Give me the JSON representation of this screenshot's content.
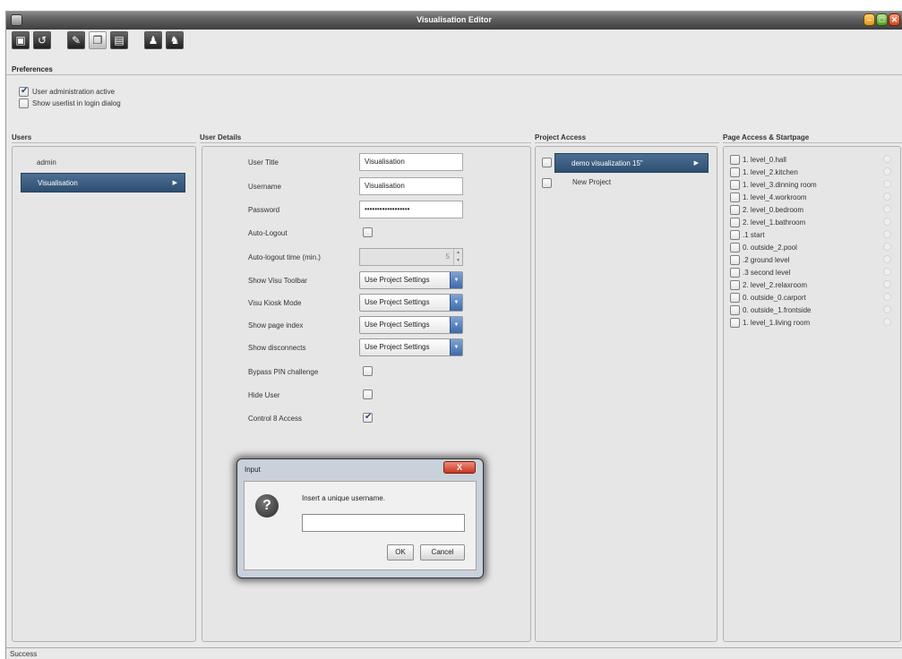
{
  "window": {
    "title": "Visualisation Editor"
  },
  "toolbar": {
    "buttons": [
      "new-icon",
      "undo-icon",
      "edit-icon",
      "copy-icon",
      "film-icon",
      "user-icon",
      "user-export-icon"
    ]
  },
  "preferences": {
    "title": "Preferences",
    "options": [
      {
        "label": "User administration active",
        "checked": true
      },
      {
        "label": "Show userlist in login dialog",
        "checked": false
      }
    ]
  },
  "users": {
    "title": "Users",
    "items": [
      "admin",
      "Visualisation"
    ],
    "selected": "Visualisation"
  },
  "user_details": {
    "title": "User Details",
    "user_title": {
      "label": "User Title",
      "value": "Visualisation"
    },
    "username": {
      "label": "Username",
      "value": "Visualisation"
    },
    "password": {
      "label": "Password",
      "value": "••••••••••••••••••"
    },
    "auto_logout": {
      "label": "Auto-Logout",
      "checked": false
    },
    "auto_logout_time": {
      "label": "Auto-logout time (min.)",
      "value": "5"
    },
    "show_visu_toolbar": {
      "label": "Show Visu Toolbar",
      "value": "Use Project Settings"
    },
    "visu_kiosk_mode": {
      "label": "Visu Kiosk Mode",
      "value": "Use Project Settings"
    },
    "show_page_index": {
      "label": "Show page index",
      "value": "Use Project Settings"
    },
    "show_disconnects": {
      "label": "Show disconnects",
      "value": "Use Project Settings"
    },
    "bypass_pin": {
      "label": "Bypass PIN challenge",
      "checked": false
    },
    "hide_user": {
      "label": "Hide User",
      "checked": false
    },
    "control8_access": {
      "label": "Control 8 Access",
      "checked": true
    }
  },
  "project_access": {
    "title": "Project Access",
    "items": [
      {
        "label": "demo visualization 15\"",
        "checked": false,
        "selected": true
      },
      {
        "label": "New Project",
        "checked": false,
        "selected": false
      }
    ]
  },
  "page_access": {
    "title": "Page Access & Startpage",
    "items": [
      "1. level_0.hall",
      "1. level_2.kitchen",
      "1. level_3.dinning room",
      "1. level_4.workroom",
      "2. level_0.bedroom",
      "2. level_1.bathroom",
      ".1 start",
      "0. outside_2.pool",
      ".2 ground level",
      ".3 second level",
      "2. level_2.relaxroom",
      "0. outside_0.carport",
      "0. outside_1.frontside",
      "1. level_1.living room"
    ]
  },
  "dialog": {
    "title": "Input",
    "close": "X",
    "message": "Insert a unique username.",
    "input_value": "",
    "ok": "OK",
    "cancel": "Cancel"
  },
  "status": {
    "text": "Success"
  }
}
